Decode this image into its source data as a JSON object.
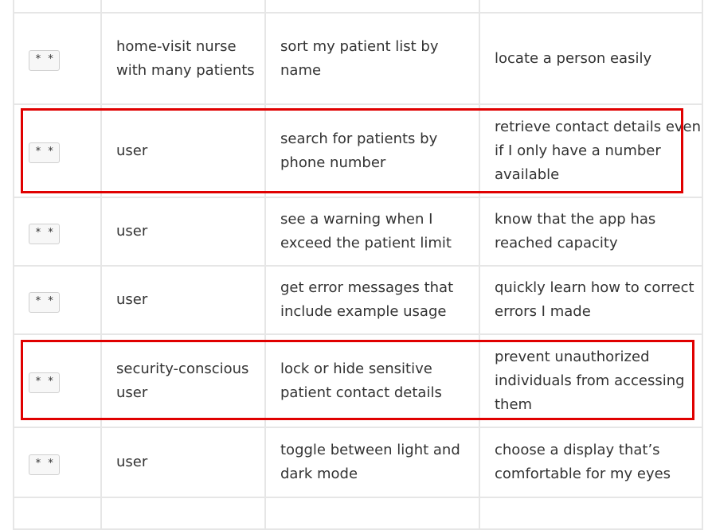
{
  "rows": [
    {
      "priority": "* *",
      "role": "",
      "want": "",
      "benefit": ""
    },
    {
      "priority": "* *",
      "role": "home-visit nurse with many patients",
      "want": "sort my patient list by name",
      "benefit": "locate a person easily"
    },
    {
      "priority": "* *",
      "role": "user",
      "want": "search for patients by phone number",
      "benefit": "retrieve contact details even if I only have a number available"
    },
    {
      "priority": "* *",
      "role": "user",
      "want": "see a warning when I exceed the patient limit",
      "benefit": "know that the app has reached capacity"
    },
    {
      "priority": "* *",
      "role": "user",
      "want": "get error messages that include example usage",
      "benefit": "quickly learn how to correct errors I made"
    },
    {
      "priority": "* *",
      "role": "security-conscious user",
      "want": "lock or hide sensitive patient contact details",
      "benefit": "prevent unauthorized individuals from accessing them"
    },
    {
      "priority": "* *",
      "role": "user",
      "want": "toggle between light and dark mode",
      "benefit": "choose a display that’s comfortable for my eyes"
    }
  ],
  "highlight_color": "#e00000"
}
